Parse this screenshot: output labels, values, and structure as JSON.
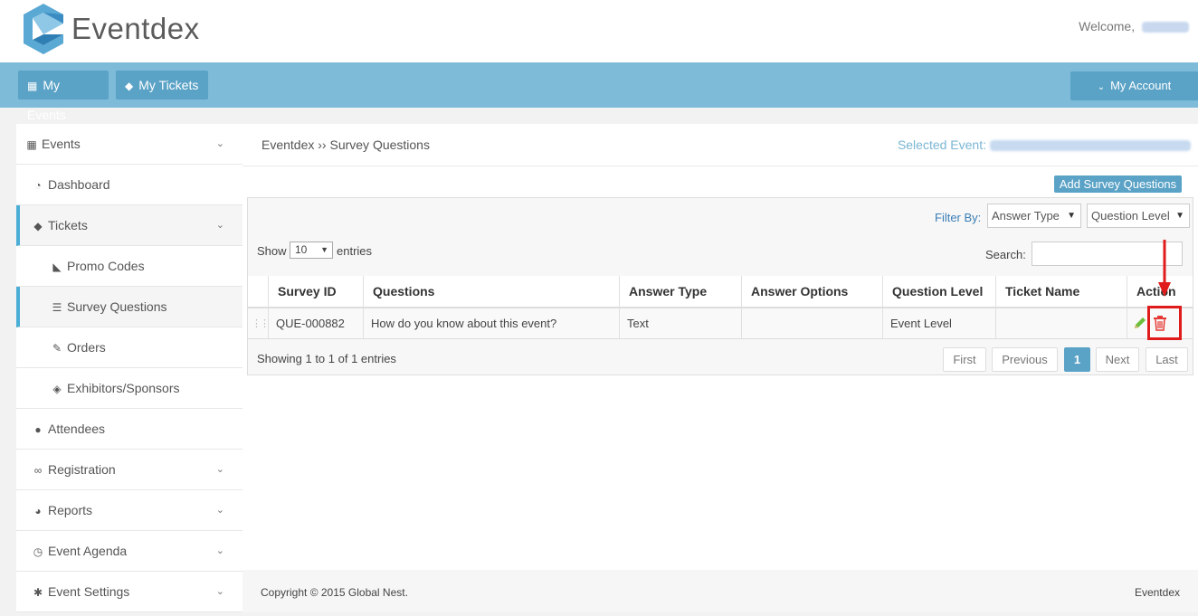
{
  "app": {
    "name": "Eventdex",
    "welcome_label": "Welcome,"
  },
  "topnav": {
    "my_events": "My Events",
    "my_tickets": "My Tickets",
    "my_account": "My Account"
  },
  "sidebar": {
    "items": [
      {
        "label": "Events",
        "icon": "calendar-icon"
      },
      {
        "label": "Dashboard",
        "icon": "dashboard-icon"
      },
      {
        "label": "Tickets",
        "icon": "ticket-icon"
      },
      {
        "label": "Promo Codes",
        "icon": "tags-icon"
      },
      {
        "label": "Survey Questions",
        "icon": "list-icon"
      },
      {
        "label": "Orders",
        "icon": "edit-icon"
      },
      {
        "label": "Exhibitors/Sponsors",
        "icon": "cube-icon"
      },
      {
        "label": "Attendees",
        "icon": "user-icon"
      },
      {
        "label": "Registration",
        "icon": "link-icon"
      },
      {
        "label": "Reports",
        "icon": "pie-chart-icon"
      },
      {
        "label": "Event Agenda",
        "icon": "clock-icon"
      },
      {
        "label": "Event Settings",
        "icon": "gear-icon"
      }
    ]
  },
  "main": {
    "breadcrumb": "Eventdex ›› Survey Questions",
    "selected_event_label": "Selected Event:",
    "add_button": "Add Survey Questions",
    "filter_by": "Filter By:",
    "filter_answer_type": "Answer Type",
    "filter_question_level": "Question Level",
    "show_label": "Show",
    "page_length": "10",
    "entries_label": "entries",
    "search_label": "Search:",
    "table": {
      "headers": [
        "Survey ID",
        "Questions",
        "Answer Type",
        "Answer Options",
        "Question Level",
        "Ticket Name",
        "Action"
      ],
      "rows": [
        {
          "survey_id": "QUE-000882",
          "question": "How do you know about this event?",
          "answer_type": "Text",
          "answer_options": "",
          "question_level": "Event Level",
          "ticket_name": ""
        }
      ]
    },
    "info": "Showing 1 to 1 of 1 entries",
    "pagination": {
      "first": "First",
      "previous": "Previous",
      "current": "1",
      "next": "Next",
      "last": "Last"
    }
  },
  "footer": {
    "copyright": "Copyright © 2015 Global Nest.",
    "brand": "Eventdex"
  },
  "colors": {
    "accent": "#5aa2c6",
    "topbar": "#7dbbd9",
    "active_border": "#4aaed7",
    "annotation": "#e01b1b",
    "delete": "#e53935",
    "edit": "#6cbf3a"
  }
}
